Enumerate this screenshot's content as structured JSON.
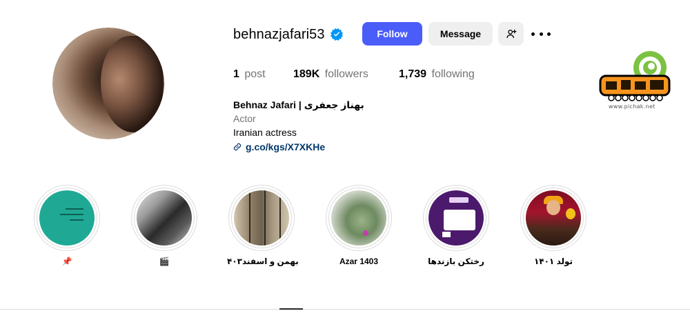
{
  "profile": {
    "username": "behnazjafari53",
    "verified": true
  },
  "actions": {
    "follow_label": "Follow",
    "message_label": "Message",
    "add_user_icon": "add-user-icon",
    "more_icon": "more-icon"
  },
  "stats": {
    "posts_count": "1",
    "posts_label": "post",
    "followers_count": "189K",
    "followers_label": "followers",
    "following_count": "1,739",
    "following_label": "following"
  },
  "bio": {
    "name": "Behnaz Jafari | بهناز جعفری",
    "category": "Actor",
    "description": "Iranian actress",
    "link": "g.co/kgs/X7XKHe"
  },
  "watermark": {
    "url": "www.pichak.net"
  },
  "highlights": [
    {
      "label": "📌",
      "image": "teal-note"
    },
    {
      "label": "🎬",
      "image": "bw-photo"
    },
    {
      "label": "بهمن و اسفند۴۰۳",
      "image": "door-photo"
    },
    {
      "label": "Azar 1403",
      "image": "plant-photo"
    },
    {
      "label": "رختکن بازندها",
      "image": "purple-poster"
    },
    {
      "label": "تولد ۱۴۰۱",
      "image": "kid-photo"
    }
  ],
  "colors": {
    "follow_button": "#4a5df9",
    "secondary_button": "#efefef",
    "verified_badge": "#0095f6",
    "muted_text": "#737373",
    "link_text": "#00376b"
  }
}
